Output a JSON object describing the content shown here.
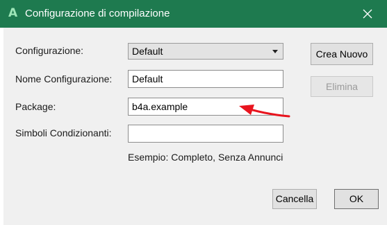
{
  "window": {
    "icon_glyph": "A",
    "title": "Configurazione di compilazione",
    "accent_color": "#1e7a4f"
  },
  "form": {
    "configuration_label": "Configurazione:",
    "configuration_value": "Default",
    "name_label": "Nome Configurazione:",
    "name_value": "Default",
    "package_label": "Package:",
    "package_value": "b4a.example",
    "symbols_label": "Simboli Condizionanti:",
    "symbols_value": "",
    "example_text": "Esempio: Completo, Senza Annunci"
  },
  "buttons": {
    "new_label": "Crea Nuovo",
    "delete_label": "Elimina",
    "cancel_label": "Cancella",
    "ok_label": "OK"
  },
  "annotation": {
    "arrow_color": "#e8141e",
    "icon": "red-arrow-icon"
  }
}
